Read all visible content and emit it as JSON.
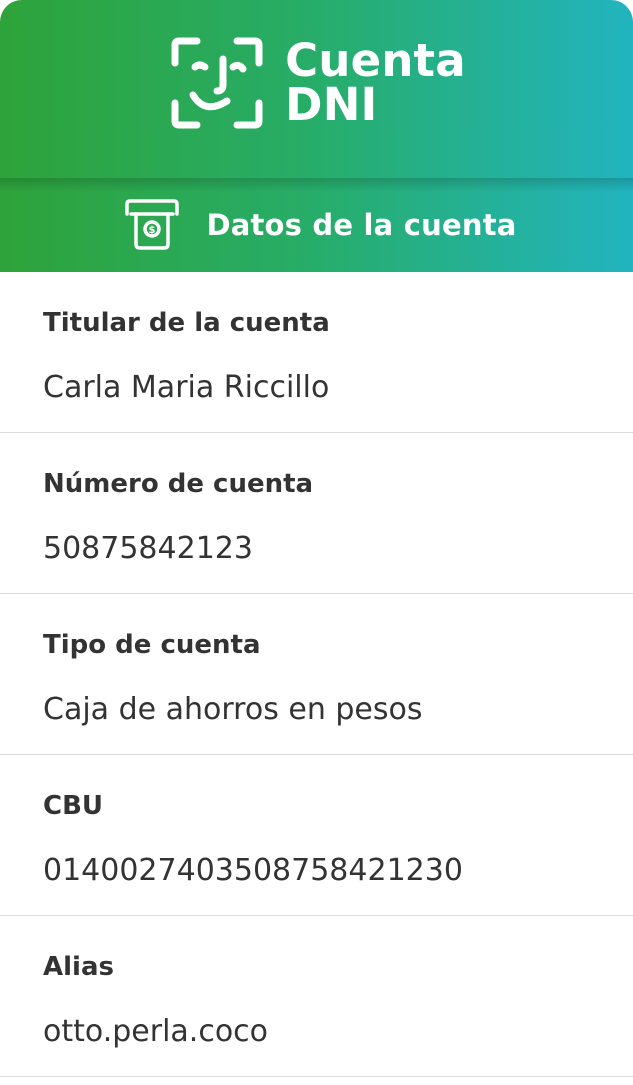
{
  "brand": {
    "line1": "Cuenta",
    "line2": "DNI",
    "logo_icon": "face-scan-icon"
  },
  "section": {
    "title": "Datos de la cuenta",
    "icon": "atm-cash-icon"
  },
  "fields": [
    {
      "label": "Titular de la cuenta",
      "value": "Carla Maria Riccillo"
    },
    {
      "label": "Número de cuenta",
      "value": "50875842123"
    },
    {
      "label": "Tipo de cuenta",
      "value": "Caja de ahorros en pesos"
    },
    {
      "label": "CBU",
      "value": "0140027403508758421230"
    },
    {
      "label": "Alias",
      "value": "otto.perla.coco"
    }
  ],
  "colors": {
    "gradient_start": "#2ea33a",
    "gradient_end": "#22b4bf",
    "text": "#333333",
    "divider": "#dcdcdc"
  }
}
